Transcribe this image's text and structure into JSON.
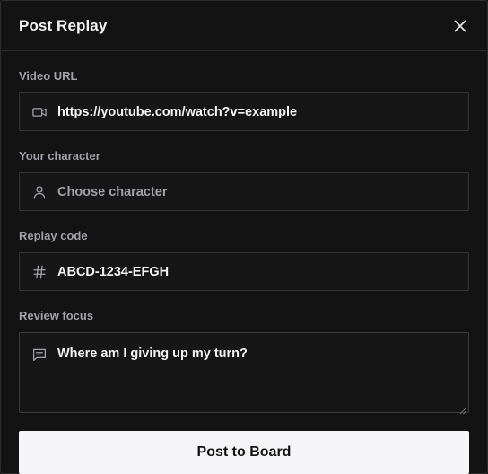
{
  "modal": {
    "title": "Post Replay",
    "close_icon": "close-icon"
  },
  "form": {
    "video_url": {
      "label": "Video URL",
      "icon": "video-camera-icon",
      "value": "https://youtube.com/watch?v=example"
    },
    "character": {
      "label": "Your character",
      "icon": "user-icon",
      "placeholder": "Choose character"
    },
    "replay_code": {
      "label": "Replay code",
      "icon": "hash-icon",
      "value": "ABCD-1234-EFGH"
    },
    "review_focus": {
      "label": "Review focus",
      "icon": "message-square-icon",
      "value": "Where am I giving up my turn?"
    }
  },
  "actions": {
    "submit_label": "Post to Board"
  },
  "colors": {
    "background": "#131313",
    "border": "#333333",
    "label": "#a1a1aa",
    "text": "#f4f4f5",
    "button_bg": "#f5f5f7",
    "button_text": "#121212"
  }
}
